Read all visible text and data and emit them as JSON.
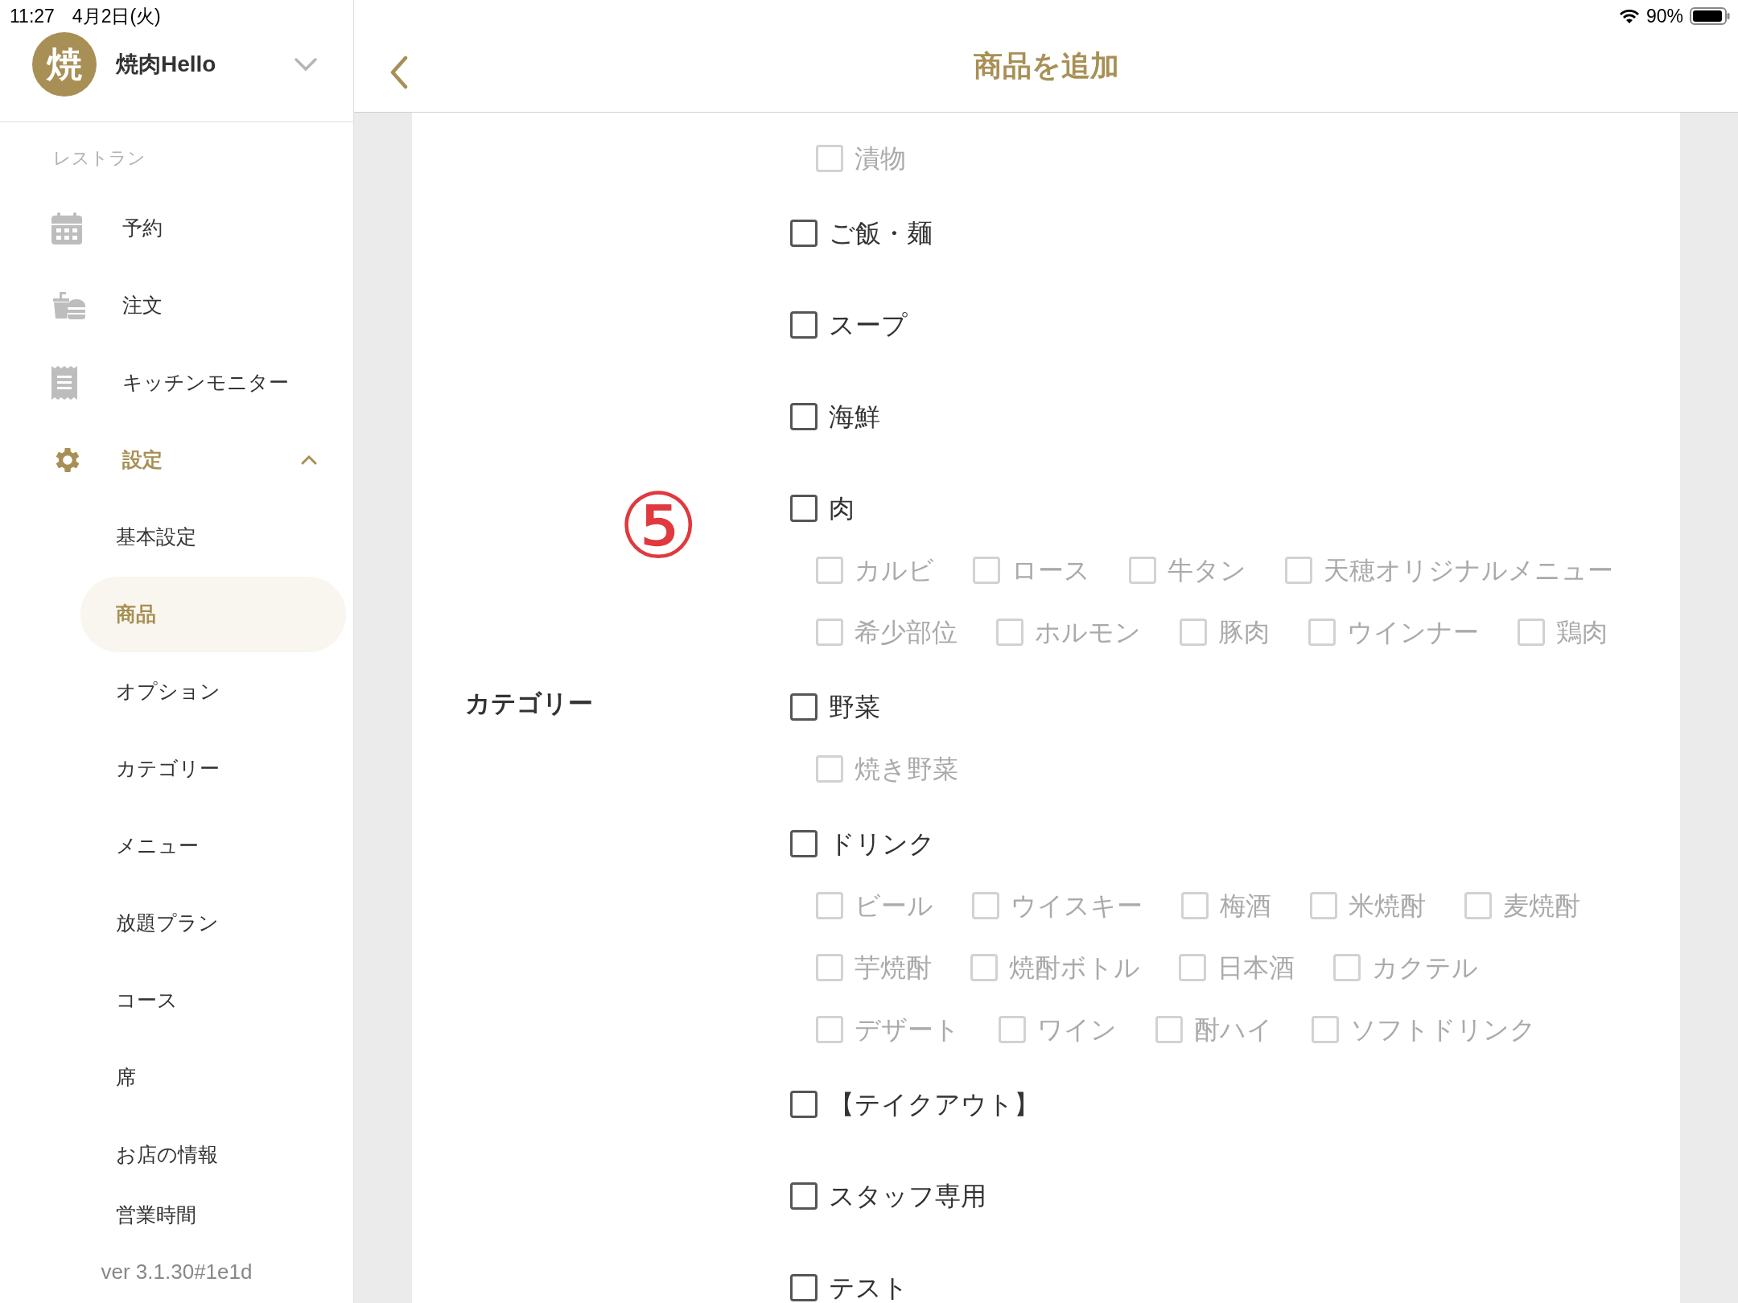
{
  "status_bar": {
    "time": "11:27",
    "date": "4月2日(火)",
    "battery": "90%"
  },
  "sidebar": {
    "avatar": "焼",
    "shop_name": "焼肉Hello",
    "section_label": "レストラン",
    "items": [
      {
        "kind": "calendar",
        "label": "予約",
        "selected": false
      },
      {
        "kind": "order",
        "label": "注文",
        "selected": false
      },
      {
        "kind": "receipt",
        "label": "キッチンモニター",
        "selected": false
      },
      {
        "kind": "gear",
        "label": "設定",
        "selected": true,
        "expanded": true,
        "children": [
          {
            "label": "基本設定",
            "selected": false
          },
          {
            "label": "商品",
            "selected": true
          },
          {
            "label": "オプション",
            "selected": false
          },
          {
            "label": "カテゴリー",
            "selected": false
          },
          {
            "label": "メニュー",
            "selected": false
          },
          {
            "label": "放題プラン",
            "selected": false
          },
          {
            "label": "コース",
            "selected": false
          },
          {
            "label": "席",
            "selected": false
          },
          {
            "label": "お店の情報",
            "selected": false
          },
          {
            "label": "営業時間",
            "selected": false
          }
        ]
      }
    ],
    "version": "ver 3.1.30#1e1d"
  },
  "header": {
    "title": "商品を追加"
  },
  "annotation": "⑤",
  "form": {
    "label": "カテゴリー",
    "categories": [
      {
        "children": [
          {
            "label": "漬物",
            "checked": false,
            "disabled": true
          }
        ]
      },
      {
        "label": "ご飯・麺",
        "checked": false,
        "disabled": false
      },
      {
        "label": "スープ",
        "checked": false,
        "disabled": false
      },
      {
        "label": "海鮮",
        "checked": false,
        "disabled": false
      },
      {
        "label": "肉",
        "checked": false,
        "disabled": false,
        "children": [
          {
            "label": "カルビ",
            "checked": false,
            "disabled": true
          },
          {
            "label": "ロース",
            "checked": false,
            "disabled": true
          },
          {
            "label": "牛タン",
            "checked": false,
            "disabled": true
          },
          {
            "label": "天穂オリジナルメニュー",
            "checked": false,
            "disabled": true
          },
          {
            "label": "希少部位",
            "checked": false,
            "disabled": true
          },
          {
            "label": "ホルモン",
            "checked": false,
            "disabled": true
          },
          {
            "label": "豚肉",
            "checked": false,
            "disabled": true
          },
          {
            "label": "ウインナー",
            "checked": false,
            "disabled": true
          },
          {
            "label": "鶏肉",
            "checked": false,
            "disabled": true
          }
        ]
      },
      {
        "label": "野菜",
        "checked": false,
        "disabled": false,
        "children": [
          {
            "label": "焼き野菜",
            "checked": false,
            "disabled": true
          }
        ]
      },
      {
        "label": "ドリンク",
        "checked": false,
        "disabled": false,
        "children": [
          {
            "label": "ビール",
            "checked": false,
            "disabled": true
          },
          {
            "label": "ウイスキー",
            "checked": false,
            "disabled": true
          },
          {
            "label": "梅酒",
            "checked": false,
            "disabled": true
          },
          {
            "label": "米焼酎",
            "checked": false,
            "disabled": true
          },
          {
            "label": "麦焼酎",
            "checked": false,
            "disabled": true
          },
          {
            "label": "芋焼酎",
            "checked": false,
            "disabled": true
          },
          {
            "label": "焼酎ボトル",
            "checked": false,
            "disabled": true
          },
          {
            "label": "日本酒",
            "checked": false,
            "disabled": true
          },
          {
            "label": "カクテル",
            "checked": false,
            "disabled": true
          },
          {
            "label": "デザート",
            "checked": false,
            "disabled": true
          },
          {
            "label": "ワイン",
            "checked": false,
            "disabled": true
          },
          {
            "label": "酎ハイ",
            "checked": false,
            "disabled": true
          },
          {
            "label": "ソフトドリンク",
            "checked": false,
            "disabled": true
          }
        ]
      },
      {
        "label": "【テイクアウト】",
        "checked": false,
        "disabled": false
      },
      {
        "label": "スタッフ専用",
        "checked": false,
        "disabled": false
      },
      {
        "label": "テスト",
        "checked": false,
        "disabled": false
      }
    ]
  }
}
